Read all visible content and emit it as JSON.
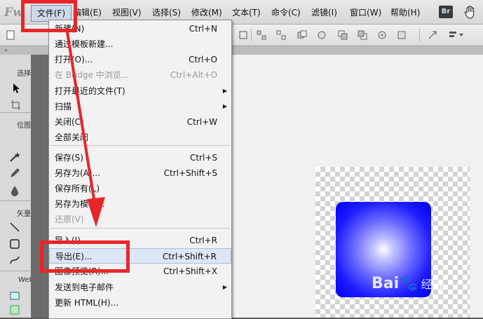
{
  "app": {
    "logo": "Fw"
  },
  "menubar": {
    "items": [
      {
        "label": "文件(F)"
      },
      {
        "label": "编辑(E)"
      },
      {
        "label": "视图(V)"
      },
      {
        "label": "选择(S)"
      },
      {
        "label": "修改(M)"
      },
      {
        "label": "文本(T)"
      },
      {
        "label": "命令(C)"
      },
      {
        "label": "滤镜(I)"
      },
      {
        "label": "窗口(W)"
      },
      {
        "label": "帮助(H)"
      }
    ],
    "br_badge": "Br"
  },
  "tools_panel": {
    "sections": [
      {
        "label": "选择"
      },
      {
        "label": "位图"
      },
      {
        "label": "矢量"
      },
      {
        "label": "Web"
      }
    ]
  },
  "file_menu": {
    "items": [
      {
        "label": "新建(N)",
        "shortcut": "Ctrl+N",
        "disabled": false
      },
      {
        "label": "通过模板新建...",
        "shortcut": "",
        "disabled": false
      },
      {
        "label": "打开(O)...",
        "shortcut": "Ctrl+O",
        "disabled": false
      },
      {
        "label": "在 Bridge 中浏览...",
        "shortcut": "Ctrl+Alt+O",
        "disabled": true
      },
      {
        "label": "打开最近的文件(T)",
        "shortcut": "",
        "submenu": true,
        "disabled": false
      },
      {
        "label": "扫描",
        "shortcut": "",
        "submenu": true,
        "disabled": false
      },
      {
        "label": "关闭(C)",
        "shortcut": "Ctrl+W",
        "disabled": false
      },
      {
        "label": "全部关闭",
        "shortcut": "",
        "disabled": false
      },
      {
        "label": "保存(S)",
        "shortcut": "Ctrl+S",
        "disabled": false
      },
      {
        "label": "另存为(A)...",
        "shortcut": "Ctrl+Shift+S",
        "disabled": false
      },
      {
        "label": "保存所有(L)",
        "shortcut": "",
        "disabled": false
      },
      {
        "label": "另存为模板...",
        "shortcut": "",
        "disabled": false
      },
      {
        "label": "还原(V)",
        "shortcut": "",
        "disabled": true
      },
      {
        "label": "导入(I)...",
        "shortcut": "Ctrl+R",
        "disabled": false
      },
      {
        "label": "导出(E)...",
        "shortcut": "Ctrl+Shift+R",
        "disabled": false,
        "highlighted": true
      },
      {
        "label": "图像预览(R)...",
        "shortcut": "Ctrl+Shift+X",
        "disabled": false
      },
      {
        "label": "发送到电子邮件",
        "shortcut": "",
        "submenu": true,
        "disabled": false
      },
      {
        "label": "更新 HTML(H)...",
        "shortcut": "",
        "disabled": false
      }
    ],
    "submenu_arrow": "▶"
  },
  "watermark": {
    "brand": "Bai",
    "paw": "🐾",
    "suffix": "经验"
  },
  "colors": {
    "annotation_red": "#e8262a",
    "highlight_bg": "#dce6f5",
    "gradient_center": "#ffffff",
    "gradient_edge": "#0000f0"
  }
}
